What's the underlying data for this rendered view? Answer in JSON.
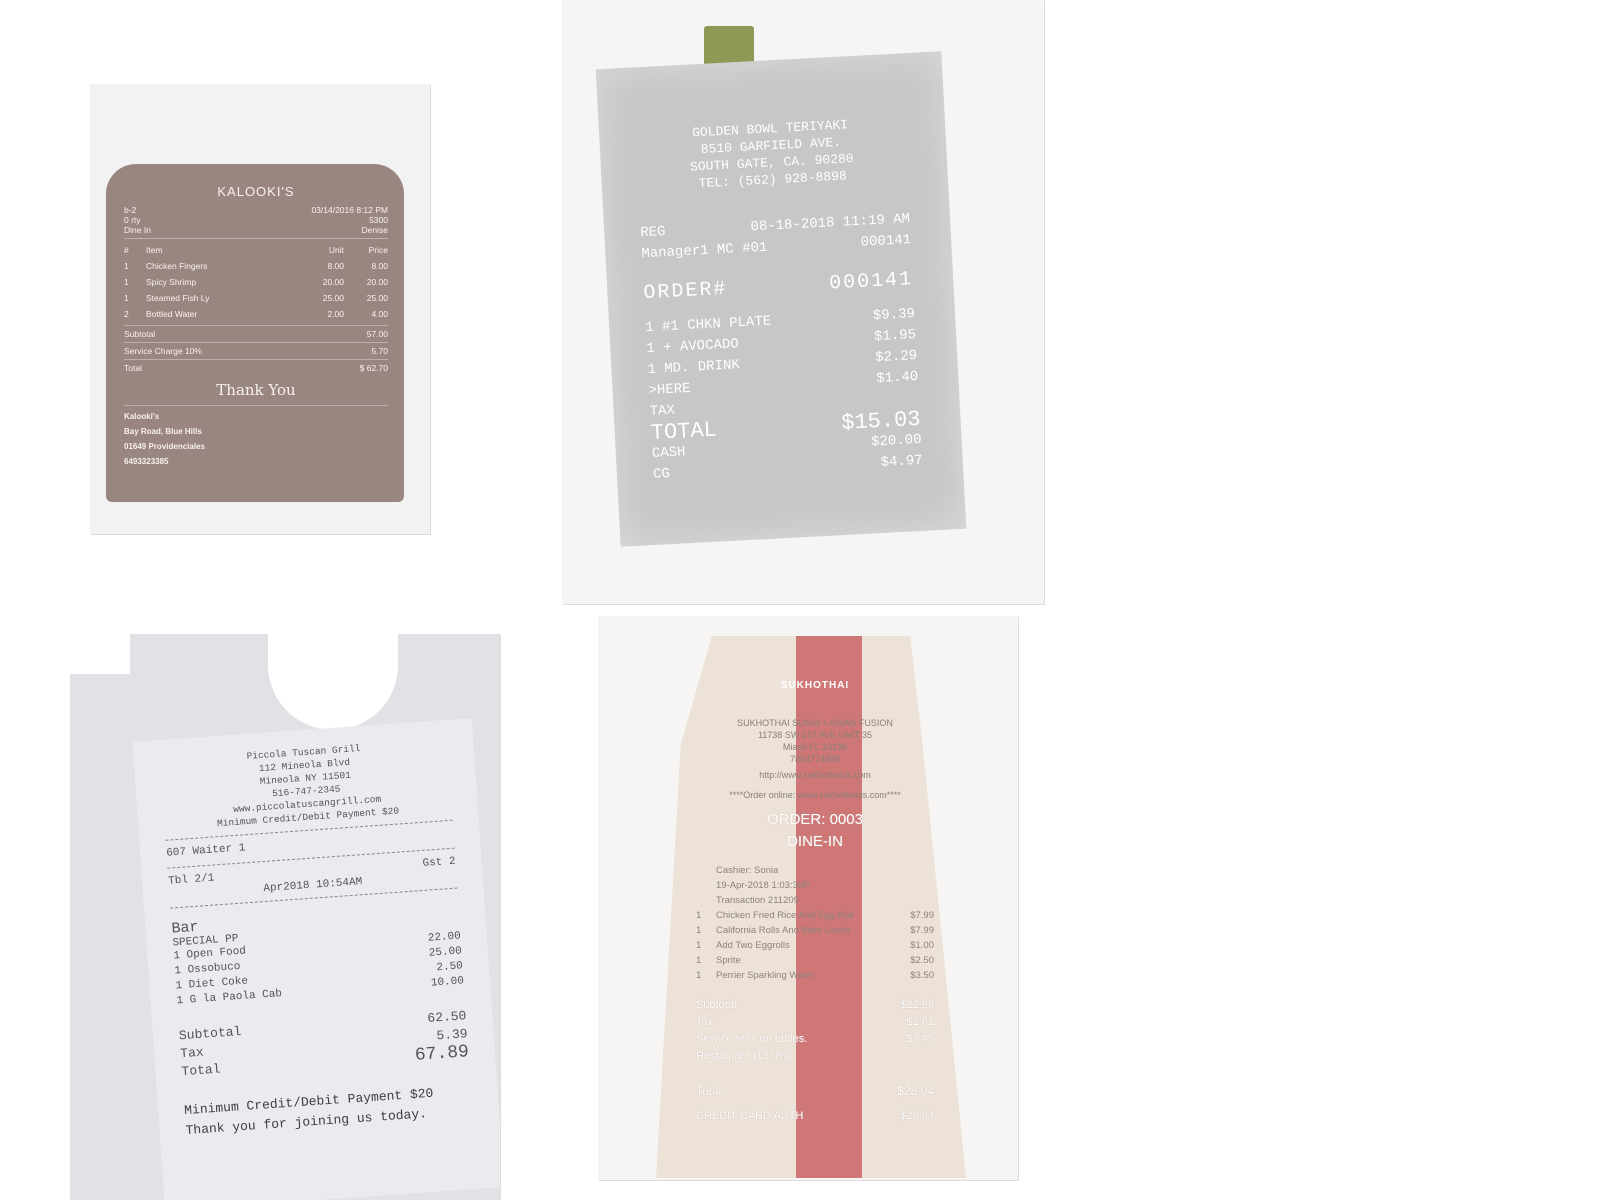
{
  "receipt1": {
    "name": "KALOOKI'S",
    "meta": [
      {
        "left": "b-2",
        "right": "03/14/2016 8:12 PM"
      },
      {
        "left": "0 rty",
        "right": "5300"
      },
      {
        "left": "Dine In",
        "right": "Denise"
      }
    ],
    "columns": {
      "qty": "#",
      "item": "Item",
      "unit": "Unit",
      "price": "Price"
    },
    "items": [
      {
        "qty": "1",
        "name": "Chicken Fingers",
        "unit": "8.00",
        "price": "8.00"
      },
      {
        "qty": "1",
        "name": "Spicy Shrimp",
        "unit": "20.00",
        "price": "20.00"
      },
      {
        "qty": "1",
        "name": "Steamed Fish Ly",
        "unit": "25.00",
        "price": "25.00"
      },
      {
        "qty": "2",
        "name": "Bottled Water",
        "unit": "2.00",
        "price": "4.00"
      }
    ],
    "subtotal_label": "Subtotal",
    "subtotal": "57.00",
    "service_label": "Service Charge 10%",
    "service": "5.70",
    "total_label": "Total",
    "total": "$ 62.70",
    "thanks": "Thank You",
    "address": [
      "Kalooki's",
      "Bay Road, Blue Hills",
      "01649 Providenciales",
      "6493323385"
    ]
  },
  "receipt2": {
    "header": [
      "GOLDEN BOWL TERIYAKI",
      "8510 GARFIELD AVE.",
      "SOUTH GATE, CA. 90280",
      "TEL: (562) 928-8898"
    ],
    "reg_label": "REG",
    "datetime": "08-18-2018 11:19 AM",
    "code": "000141",
    "manager": "Manager1",
    "mc": "MC #01",
    "order_label": "ORDER#",
    "order_no": "000141",
    "items": [
      {
        "name": "1 #1 CHKN PLATE",
        "price": "$9.39"
      },
      {
        "name": "1 + AVOCADO",
        "price": "$1.95"
      },
      {
        "name": "1 MD. DRINK",
        "price": "$2.29"
      }
    ],
    "here": ">HERE",
    "tax_label": "TAX",
    "tax": "$1.40",
    "total_label": "TOTAL",
    "total": "$15.03",
    "cash_label": "CASH",
    "cash": "$20.00",
    "cg_label": "CG",
    "cg": "$4.97"
  },
  "receipt3": {
    "header": [
      "Piccola Tuscan Grill",
      "112 Mineola Blvd",
      "Mineola NY 11501",
      "516-747-2345",
      "www.piccolatuscangrill.com",
      "Minimum Credit/Debit Payment $20"
    ],
    "server": "607 Waiter 1",
    "table": "Tbl 2/1",
    "guests": "Gst 2",
    "datetime": "Apr2018 10:54AM",
    "section": "Bar",
    "subsection": "SPECIAL PP",
    "items": [
      {
        "name": "1 Open Food",
        "price": "22.00"
      },
      {
        "name": "1 Ossobuco",
        "price": "25.00"
      },
      {
        "name": "1 Diet Coke",
        "price": "2.50"
      },
      {
        "name": "1 G la Paola Cab",
        "price": "10.00"
      }
    ],
    "subtotal_label": "Subtotal",
    "subtotal": "62.50",
    "tax_label": "Tax",
    "tax": "5.39",
    "total_label": "Total",
    "total": "67.89",
    "footer1": "Minimum Credit/Debit Payment $20",
    "footer2": "Thank you for joining us today."
  },
  "receipt4": {
    "logo": "SUKHOTHAI",
    "header": [
      "SUKHOTHAI SUSHI + ASIAN FUSION",
      "11738 SW 147 AVE UNIT 35",
      "Miami FL 33196",
      "7864774888"
    ],
    "url": "http://www.sukhothaius.com",
    "online": "****Order online: www.sukhothaius.com****",
    "order": "ORDER: 0003",
    "dine": "DINE-IN",
    "cashier": "Cashier: Sonia",
    "datetime": "19-Apr-2018 1:03:30P",
    "transaction": "Transaction 211209",
    "items": [
      {
        "qty": "1",
        "name": "Chicken Fried Rice And Egg Roll",
        "price": "$7.99"
      },
      {
        "qty": "1",
        "name": "California Rolls And Miso Lunch",
        "price": "$7.99"
      },
      {
        "qty": "1",
        "name": "Add Two Eggrolls",
        "price": "$1.00"
      },
      {
        "qty": "1",
        "name": "Sprite",
        "price": "$2.50"
      },
      {
        "qty": "1",
        "name": "Perrier Sparkling Water",
        "price": "$3.50"
      }
    ],
    "subtotal_label": "Subtotal",
    "subtotal": "$22.98",
    "tax_label": "Tax",
    "tax": "$1.61",
    "service_label": "Service fees on tables.",
    "service": "$3.45",
    "service_label2": "Restaurant (15.0%)",
    "total_label": "Total",
    "total": "$28.04",
    "auth_label": "CREDIT CARD AUTH",
    "auth": "$28.04"
  },
  "colors": {
    "receipt1_paper": "#9a8680",
    "receipt2_paper": "#c5c7c9",
    "receipt3_paper": "#eceaee",
    "receipt4_paper": "#ece2d8",
    "receipt4_stripe": "#c44e52"
  }
}
